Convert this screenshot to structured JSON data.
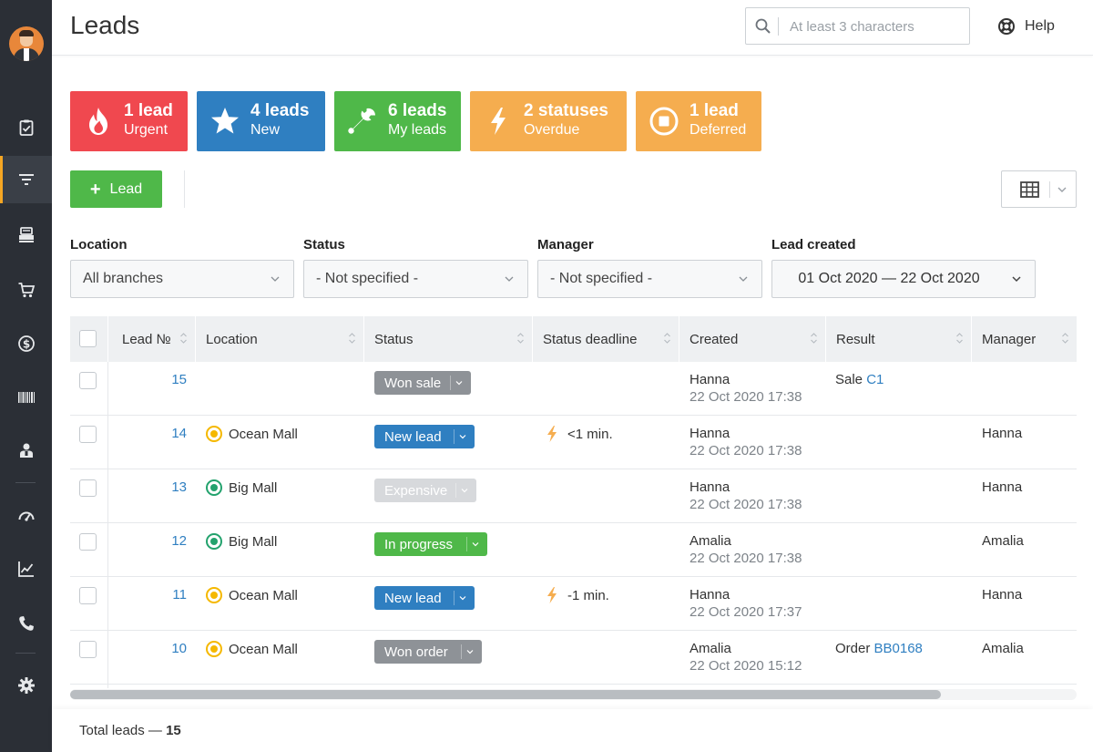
{
  "header": {
    "title": "Leads",
    "search_placeholder": "At least 3 characters",
    "help_label": "Help"
  },
  "sidebar": {
    "items": [
      {
        "icon": "clipboard-check-icon"
      },
      {
        "icon": "funnel-icon",
        "active": true
      },
      {
        "icon": "cash-register-icon"
      },
      {
        "icon": "shopping-cart-icon"
      },
      {
        "icon": "dollar-circle-icon"
      },
      {
        "icon": "barcode-icon"
      },
      {
        "icon": "user-badge-icon"
      },
      {
        "icon": "speedometer-icon"
      },
      {
        "icon": "line-chart-icon"
      },
      {
        "icon": "phone-icon"
      },
      {
        "icon": "gear-icon"
      }
    ]
  },
  "tiles": [
    {
      "count": "1 lead",
      "label": "Urgent",
      "color": "#f0484f",
      "icon": "flame-icon"
    },
    {
      "count": "4 leads",
      "label": "New",
      "color": "#2f7fc1",
      "icon": "star-icon"
    },
    {
      "count": "6 leads",
      "label": "My leads",
      "color": "#4fb849",
      "icon": "wrench-icon"
    },
    {
      "count": "2 statuses",
      "label": "Overdue",
      "color": "#f5ad4f",
      "icon": "lightning-icon"
    },
    {
      "count": "1 lead",
      "label": "Deferred",
      "color": "#f5ad4f",
      "icon": "stop-circle-icon"
    }
  ],
  "toolbar": {
    "add_lead_label": "Lead"
  },
  "filters": {
    "location": {
      "label": "Location",
      "value": "All branches"
    },
    "status": {
      "label": "Status",
      "value": "- Not specified -"
    },
    "manager": {
      "label": "Manager",
      "value": "- Not specified -"
    },
    "created": {
      "label": "Lead created",
      "value": "01 Oct 2020 — 22 Oct 2020"
    }
  },
  "table": {
    "columns": [
      "Lead №",
      "Location",
      "Status",
      "Status deadline",
      "Created",
      "Result",
      "Manager"
    ],
    "rows": [
      {
        "no": "15",
        "location": "",
        "location_color": "",
        "status": "Won sale",
        "status_color": "#8e9297",
        "deadline": "",
        "created_by": "Hanna",
        "created_at": "22 Oct 2020 17:38",
        "result_text": "Sale",
        "result_link": "C1",
        "manager": ""
      },
      {
        "no": "14",
        "location": "Ocean Mall",
        "location_color": "#f5b800",
        "status": "New lead",
        "status_color": "#2f7fc1",
        "deadline": "<1 min.",
        "created_by": "Hanna",
        "created_at": "22 Oct 2020 17:38",
        "result_text": "",
        "result_link": "",
        "manager": "Hanna"
      },
      {
        "no": "13",
        "location": "Big Mall",
        "location_color": "#23a26d",
        "status": "Expensive",
        "status_color": "#d7d9dc",
        "deadline": "",
        "created_by": "Hanna",
        "created_at": "22 Oct 2020 17:38",
        "result_text": "",
        "result_link": "",
        "manager": "Hanna"
      },
      {
        "no": "12",
        "location": "Big Mall",
        "location_color": "#23a26d",
        "status": "In progress",
        "status_color": "#4fb849",
        "deadline": "",
        "created_by": "Amalia",
        "created_at": "22 Oct 2020 17:38",
        "result_text": "",
        "result_link": "",
        "manager": "Amalia"
      },
      {
        "no": "11",
        "location": "Ocean Mall",
        "location_color": "#f5b800",
        "status": "New lead",
        "status_color": "#2f7fc1",
        "deadline": "-1 min.",
        "created_by": "Hanna",
        "created_at": "22 Oct 2020 17:37",
        "result_text": "",
        "result_link": "",
        "manager": "Hanna"
      },
      {
        "no": "10",
        "location": "Ocean Mall",
        "location_color": "#f5b800",
        "status": "Won order",
        "status_color": "#8e9297",
        "deadline": "",
        "created_by": "Amalia",
        "created_at": "22 Oct 2020 15:12",
        "result_text": "Order",
        "result_link": "BB0168",
        "manager": "Amalia"
      }
    ]
  },
  "footer": {
    "total_label": "Total leads —",
    "total_count": "15"
  }
}
